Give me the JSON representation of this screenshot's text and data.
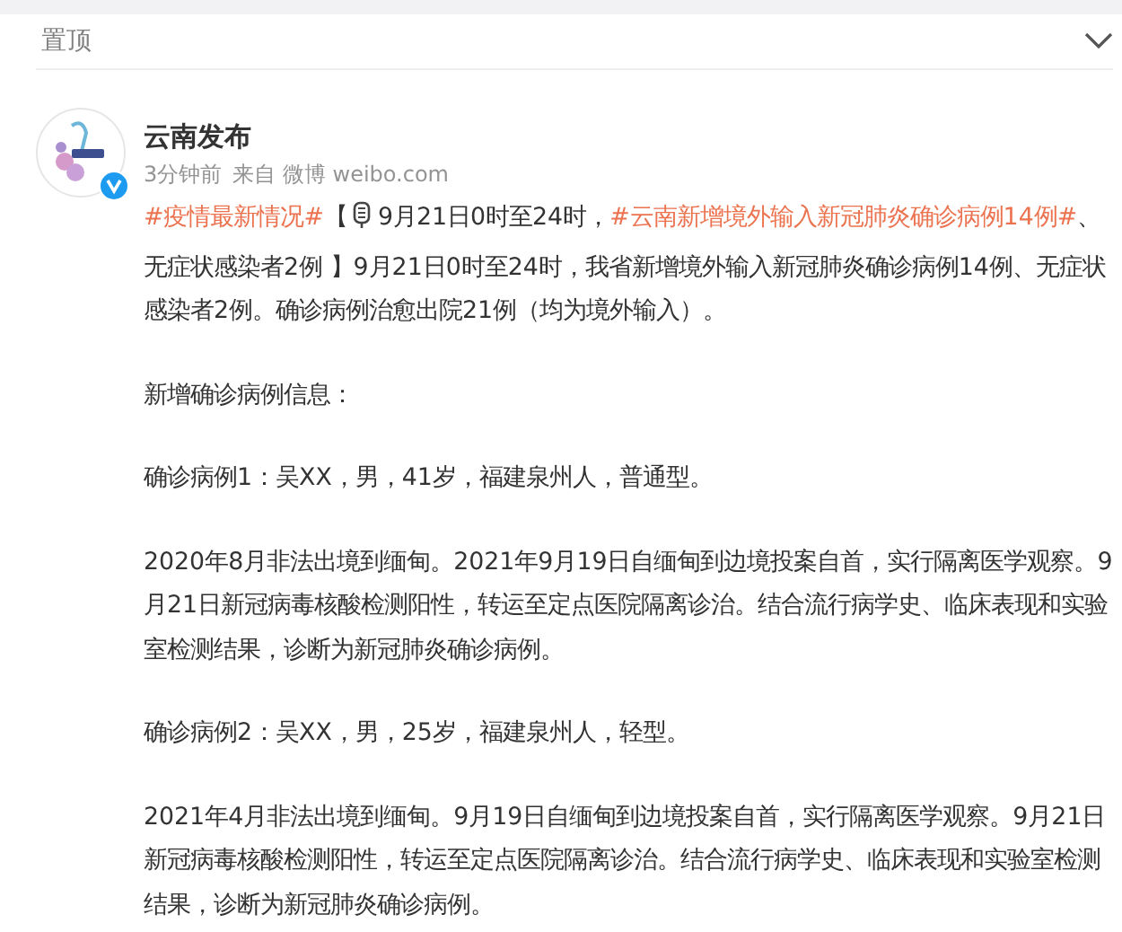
{
  "header": {
    "label": "置顶",
    "expanded": false
  },
  "post": {
    "author": "云南发布",
    "verified": true,
    "time": "3分钟前",
    "source": "来自 微博 weibo.com",
    "paragraphs": [
      [
        {
          "kind": "topic",
          "text": "#疫情最新情况#"
        },
        {
          "kind": "text",
          "text": "【"
        },
        {
          "kind": "mic"
        },
        {
          "kind": "text",
          "text": "9月21日0时至24时，"
        },
        {
          "kind": "topic",
          "text": "#云南新增境外输入新冠肺炎确诊病例14例#"
        },
        {
          "kind": "text",
          "text": "、无症状感染者2例 】9月21日0时至24时，我省新增境外输入新冠肺炎确诊病例14例、无症状感染者2例。确诊病例治愈出院21例（均为境外输入）。"
        }
      ],
      [
        {
          "kind": "text",
          "text": "新增确诊病例信息："
        }
      ],
      [
        {
          "kind": "text",
          "text": "确诊病例1：吴XX，男，41岁，福建泉州人，普通型。"
        }
      ],
      [
        {
          "kind": "text",
          "text": "2020年8月非法出境到缅甸。2021年9月19日自缅甸到边境投案自首，实行隔离医学观察。9月21日新冠病毒核酸检测阳性，转运至定点医院隔离诊治。结合流行病学史、临床表现和实验室检测结果，诊断为新冠肺炎确诊病例。"
        }
      ],
      [
        {
          "kind": "text",
          "text": "确诊病例2：吴XX，男，25岁，福建泉州人，轻型。"
        }
      ],
      [
        {
          "kind": "text",
          "text": "2021年4月非法出境到缅甸。9月19日自缅甸到边境投案自首，实行隔离医学观察。9月21日新冠病毒核酸检测阳性，转运至定点医院隔离诊治。结合流行病学史、临床表现和实验室检测结果，诊断为新冠肺炎确诊病例。"
        }
      ]
    ]
  }
}
